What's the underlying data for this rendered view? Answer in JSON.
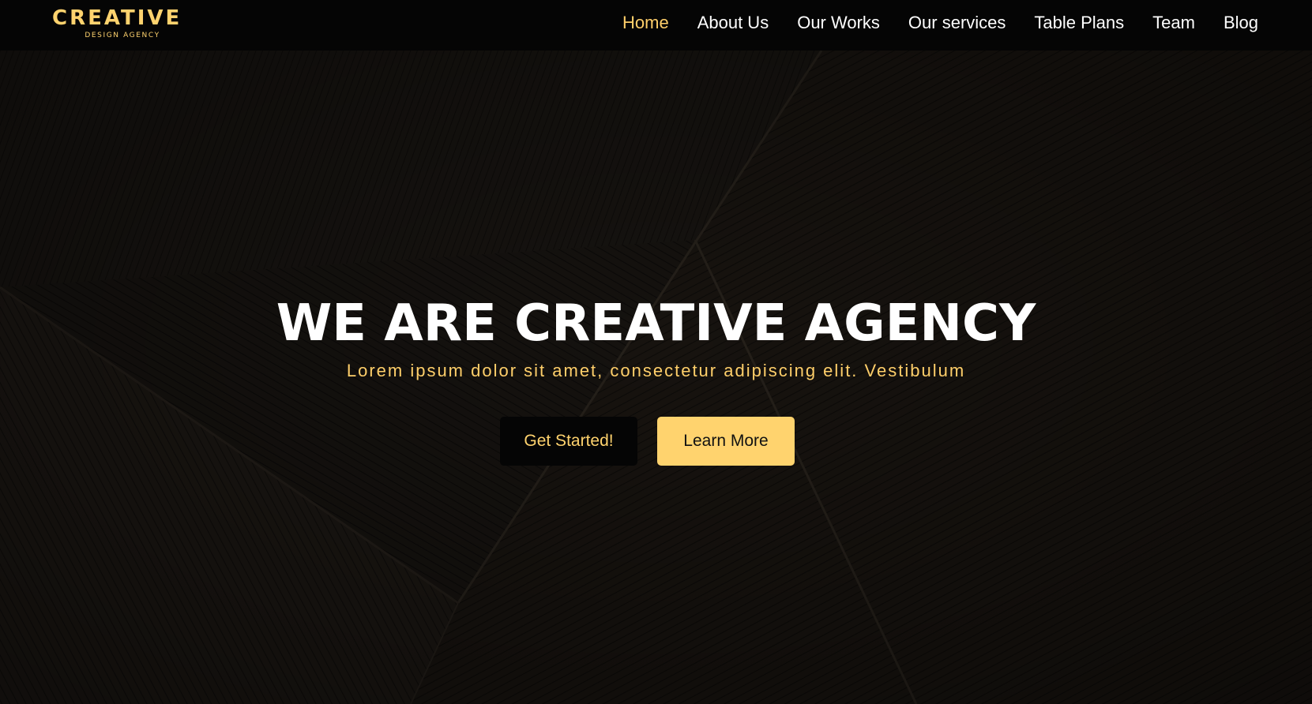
{
  "brand": {
    "name": "CREATIVE",
    "tagline": "DESIGN AGENCY",
    "accent_color": "#ffd36e"
  },
  "nav": {
    "items": [
      {
        "label": "Home",
        "active": true
      },
      {
        "label": "About Us",
        "active": false
      },
      {
        "label": "Our Works",
        "active": false
      },
      {
        "label": "Our services",
        "active": false
      },
      {
        "label": "Table Plans",
        "active": false
      },
      {
        "label": "Team",
        "active": false
      },
      {
        "label": "Blog",
        "active": false
      }
    ]
  },
  "hero": {
    "title": "WE ARE CREATIVE AGENCY",
    "subtitle": "Lorem ipsum dolor sit amet, consectetur adipiscing elit. Vestibulum",
    "primary_button": "Get Started!",
    "secondary_button": "Learn More"
  },
  "colors": {
    "background": "#15120f",
    "navbar": "#050505",
    "accent": "#ffd36e",
    "text": "#ffffff"
  }
}
